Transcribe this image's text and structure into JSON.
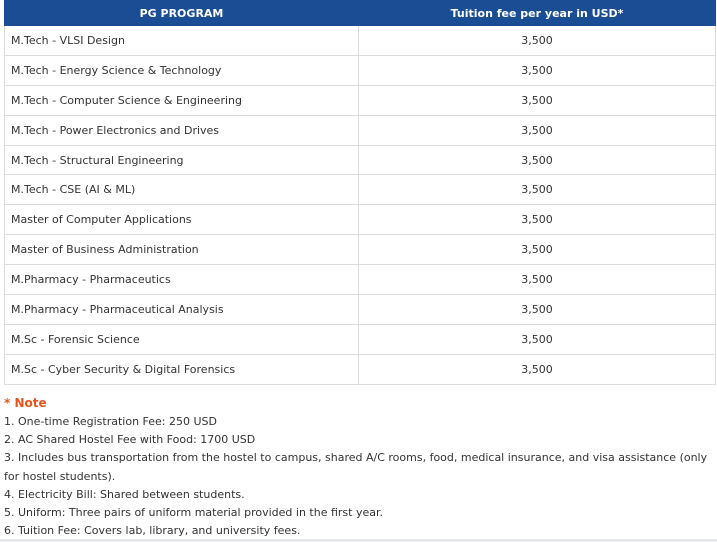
{
  "table": {
    "headers": [
      "PG PROGRAM",
      "Tuition fee per year in USD*"
    ],
    "rows": [
      {
        "program": "M.Tech - VLSI Design",
        "fee": "3,500"
      },
      {
        "program": "M.Tech - Energy Science & Technology",
        "fee": "3,500"
      },
      {
        "program": "M.Tech - Computer Science & Engineering",
        "fee": "3,500"
      },
      {
        "program": "M.Tech - Power Electronics and Drives",
        "fee": "3,500"
      },
      {
        "program": "M.Tech - Structural Engineering",
        "fee": "3,500"
      },
      {
        "program": "M.Tech - CSE (AI & ML)",
        "fee": "3,500"
      },
      {
        "program": "Master of Computer Applications",
        "fee": "3,500"
      },
      {
        "program": "Master of Business Administration",
        "fee": "3,500"
      },
      {
        "program": "M.Pharmacy - Pharmaceutics",
        "fee": "3,500"
      },
      {
        "program": "M.Pharmacy - Pharmaceutical Analysis",
        "fee": "3,500"
      },
      {
        "program": "M.Sc - Forensic Science",
        "fee": "3,500"
      },
      {
        "program": "M.Sc - Cyber Security & Digital Forensics",
        "fee": "3,500"
      }
    ]
  },
  "note": {
    "title": "* Note",
    "items": [
      "1. One-time Registration Fee: 250 USD",
      "2. AC Shared Hostel Fee with Food: 1700 USD",
      "3. Includes bus transportation from the hostel to campus, shared A/C rooms, food, medical insurance, and visa assistance (only for hostel students).",
      "4. Electricity Bill: Shared between students.",
      "5. Uniform: Three pairs of uniform material provided in the first year.",
      "6. Tuition Fee: Covers lab, library, and university fees."
    ]
  },
  "colors": {
    "header_bg": "#1b4d95",
    "note_accent": "#e8541c"
  }
}
